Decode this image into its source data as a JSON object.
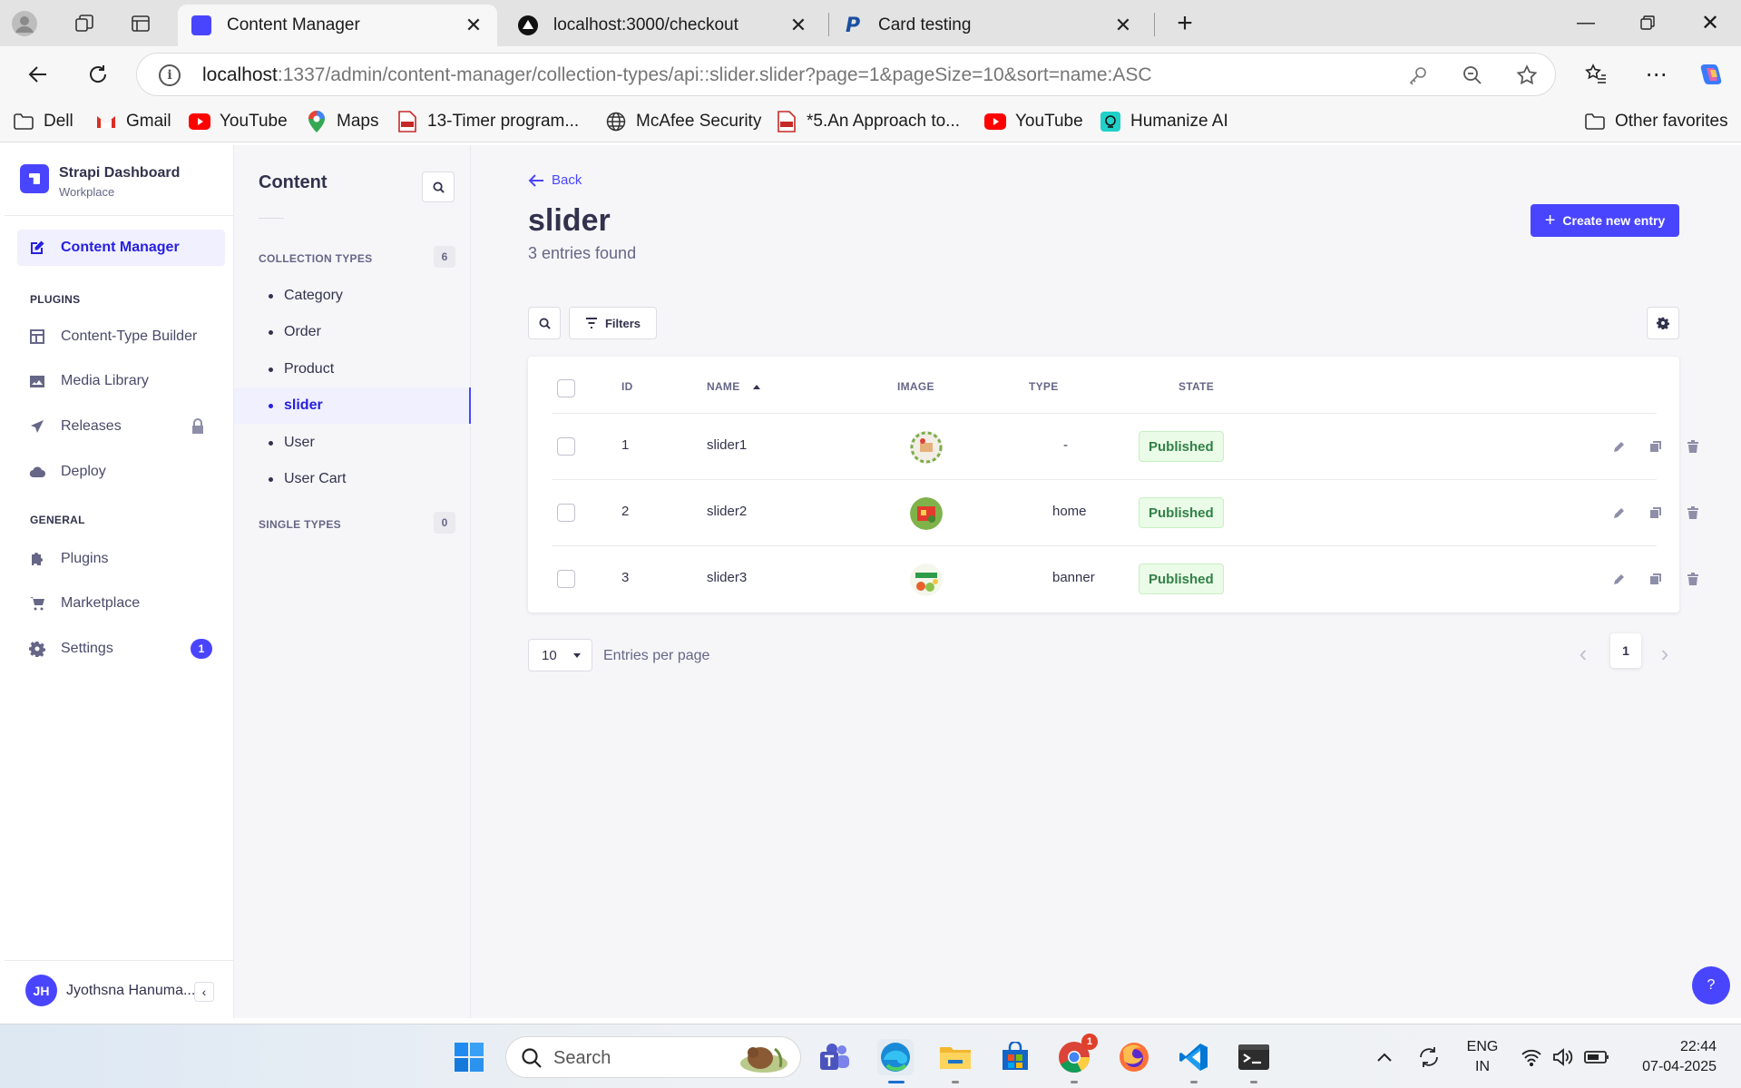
{
  "browser": {
    "tabs": [
      {
        "title": "Content Manager",
        "active": true
      },
      {
        "title": "localhost:3000/checkout",
        "active": false
      },
      {
        "title": "Card testing",
        "active": false
      }
    ],
    "url_host": "localhost",
    "url_rest": ":1337/admin/content-manager/collection-types/api::slider.slider?page=1&pageSize=10&sort=name:ASC",
    "bookmarks": [
      "Dell",
      "Gmail",
      "YouTube",
      "Maps",
      "13-Timer program...",
      "McAfee Security",
      "*5.An Approach to...",
      "YouTube",
      "Humanize AI"
    ],
    "other_favorites": "Other favorites"
  },
  "sidebar": {
    "brand_title": "Strapi Dashboard",
    "brand_subtitle": "Workplace",
    "content_manager": "Content Manager",
    "plugins_heading": "PLUGINS",
    "plugins": [
      "Content-Type Builder",
      "Media Library",
      "Releases",
      "Deploy"
    ],
    "general_heading": "GENERAL",
    "general": [
      "Plugins",
      "Marketplace",
      "Settings"
    ],
    "settings_badge": "1",
    "user_initials": "JH",
    "user_name": "Jyothsna Hanuma..."
  },
  "subnav": {
    "title": "Content",
    "collection_heading": "COLLECTION TYPES",
    "collection_count": "6",
    "collection_types": [
      "Category",
      "Order",
      "Product",
      "slider",
      "User",
      "User Cart"
    ],
    "active": "slider",
    "single_heading": "SINGLE TYPES",
    "single_count": "0"
  },
  "main": {
    "back_label": "Back",
    "title": "slider",
    "subtitle": "3 entries found",
    "create_label": "Create new entry",
    "filters_label": "Filters",
    "columns": [
      "ID",
      "NAME",
      "IMAGE",
      "TYPE",
      "STATE"
    ],
    "rows": [
      {
        "id": "1",
        "name": "slider1",
        "type": "-",
        "state": "Published"
      },
      {
        "id": "2",
        "name": "slider2",
        "type": "home",
        "state": "Published"
      },
      {
        "id": "3",
        "name": "slider3",
        "type": "banner",
        "state": "Published"
      }
    ],
    "page_size": "10",
    "entries_per_page": "Entries per page",
    "current_page": "1",
    "help": "?"
  },
  "taskbar": {
    "search_placeholder": "Search",
    "lang_line1": "ENG",
    "lang_line2": "IN",
    "time": "22:44",
    "date": "07-04-2025",
    "chrome_badge": "1"
  },
  "colors": {
    "primary": "#4945ff",
    "published_bg": "#eafbe7",
    "published_text": "#328048"
  }
}
